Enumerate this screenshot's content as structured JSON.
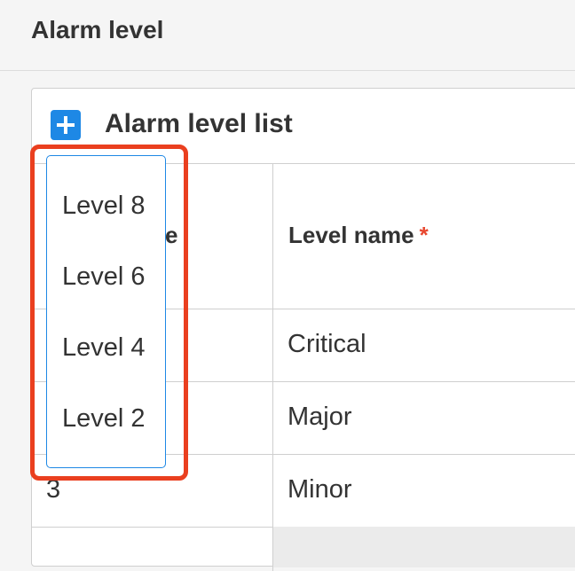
{
  "page": {
    "title": "Alarm level"
  },
  "panel": {
    "title": "Alarm level list",
    "add_icon": "plus-icon"
  },
  "table": {
    "columns": [
      {
        "label": "e",
        "note": "partially hidden 'Level' column header"
      },
      {
        "label": "Level name",
        "required_mark": "*"
      }
    ],
    "rows": [
      {
        "level": "",
        "name": "Critical"
      },
      {
        "level": "",
        "name": "Major"
      },
      {
        "level": "3",
        "name": "Minor"
      }
    ]
  },
  "dropdown": {
    "options": [
      "Level 8",
      "Level 6",
      "Level 4",
      "Level 2"
    ]
  },
  "colors": {
    "accent": "#1e88e5",
    "highlight": "#ea3f1f",
    "required": "#e8472f"
  }
}
